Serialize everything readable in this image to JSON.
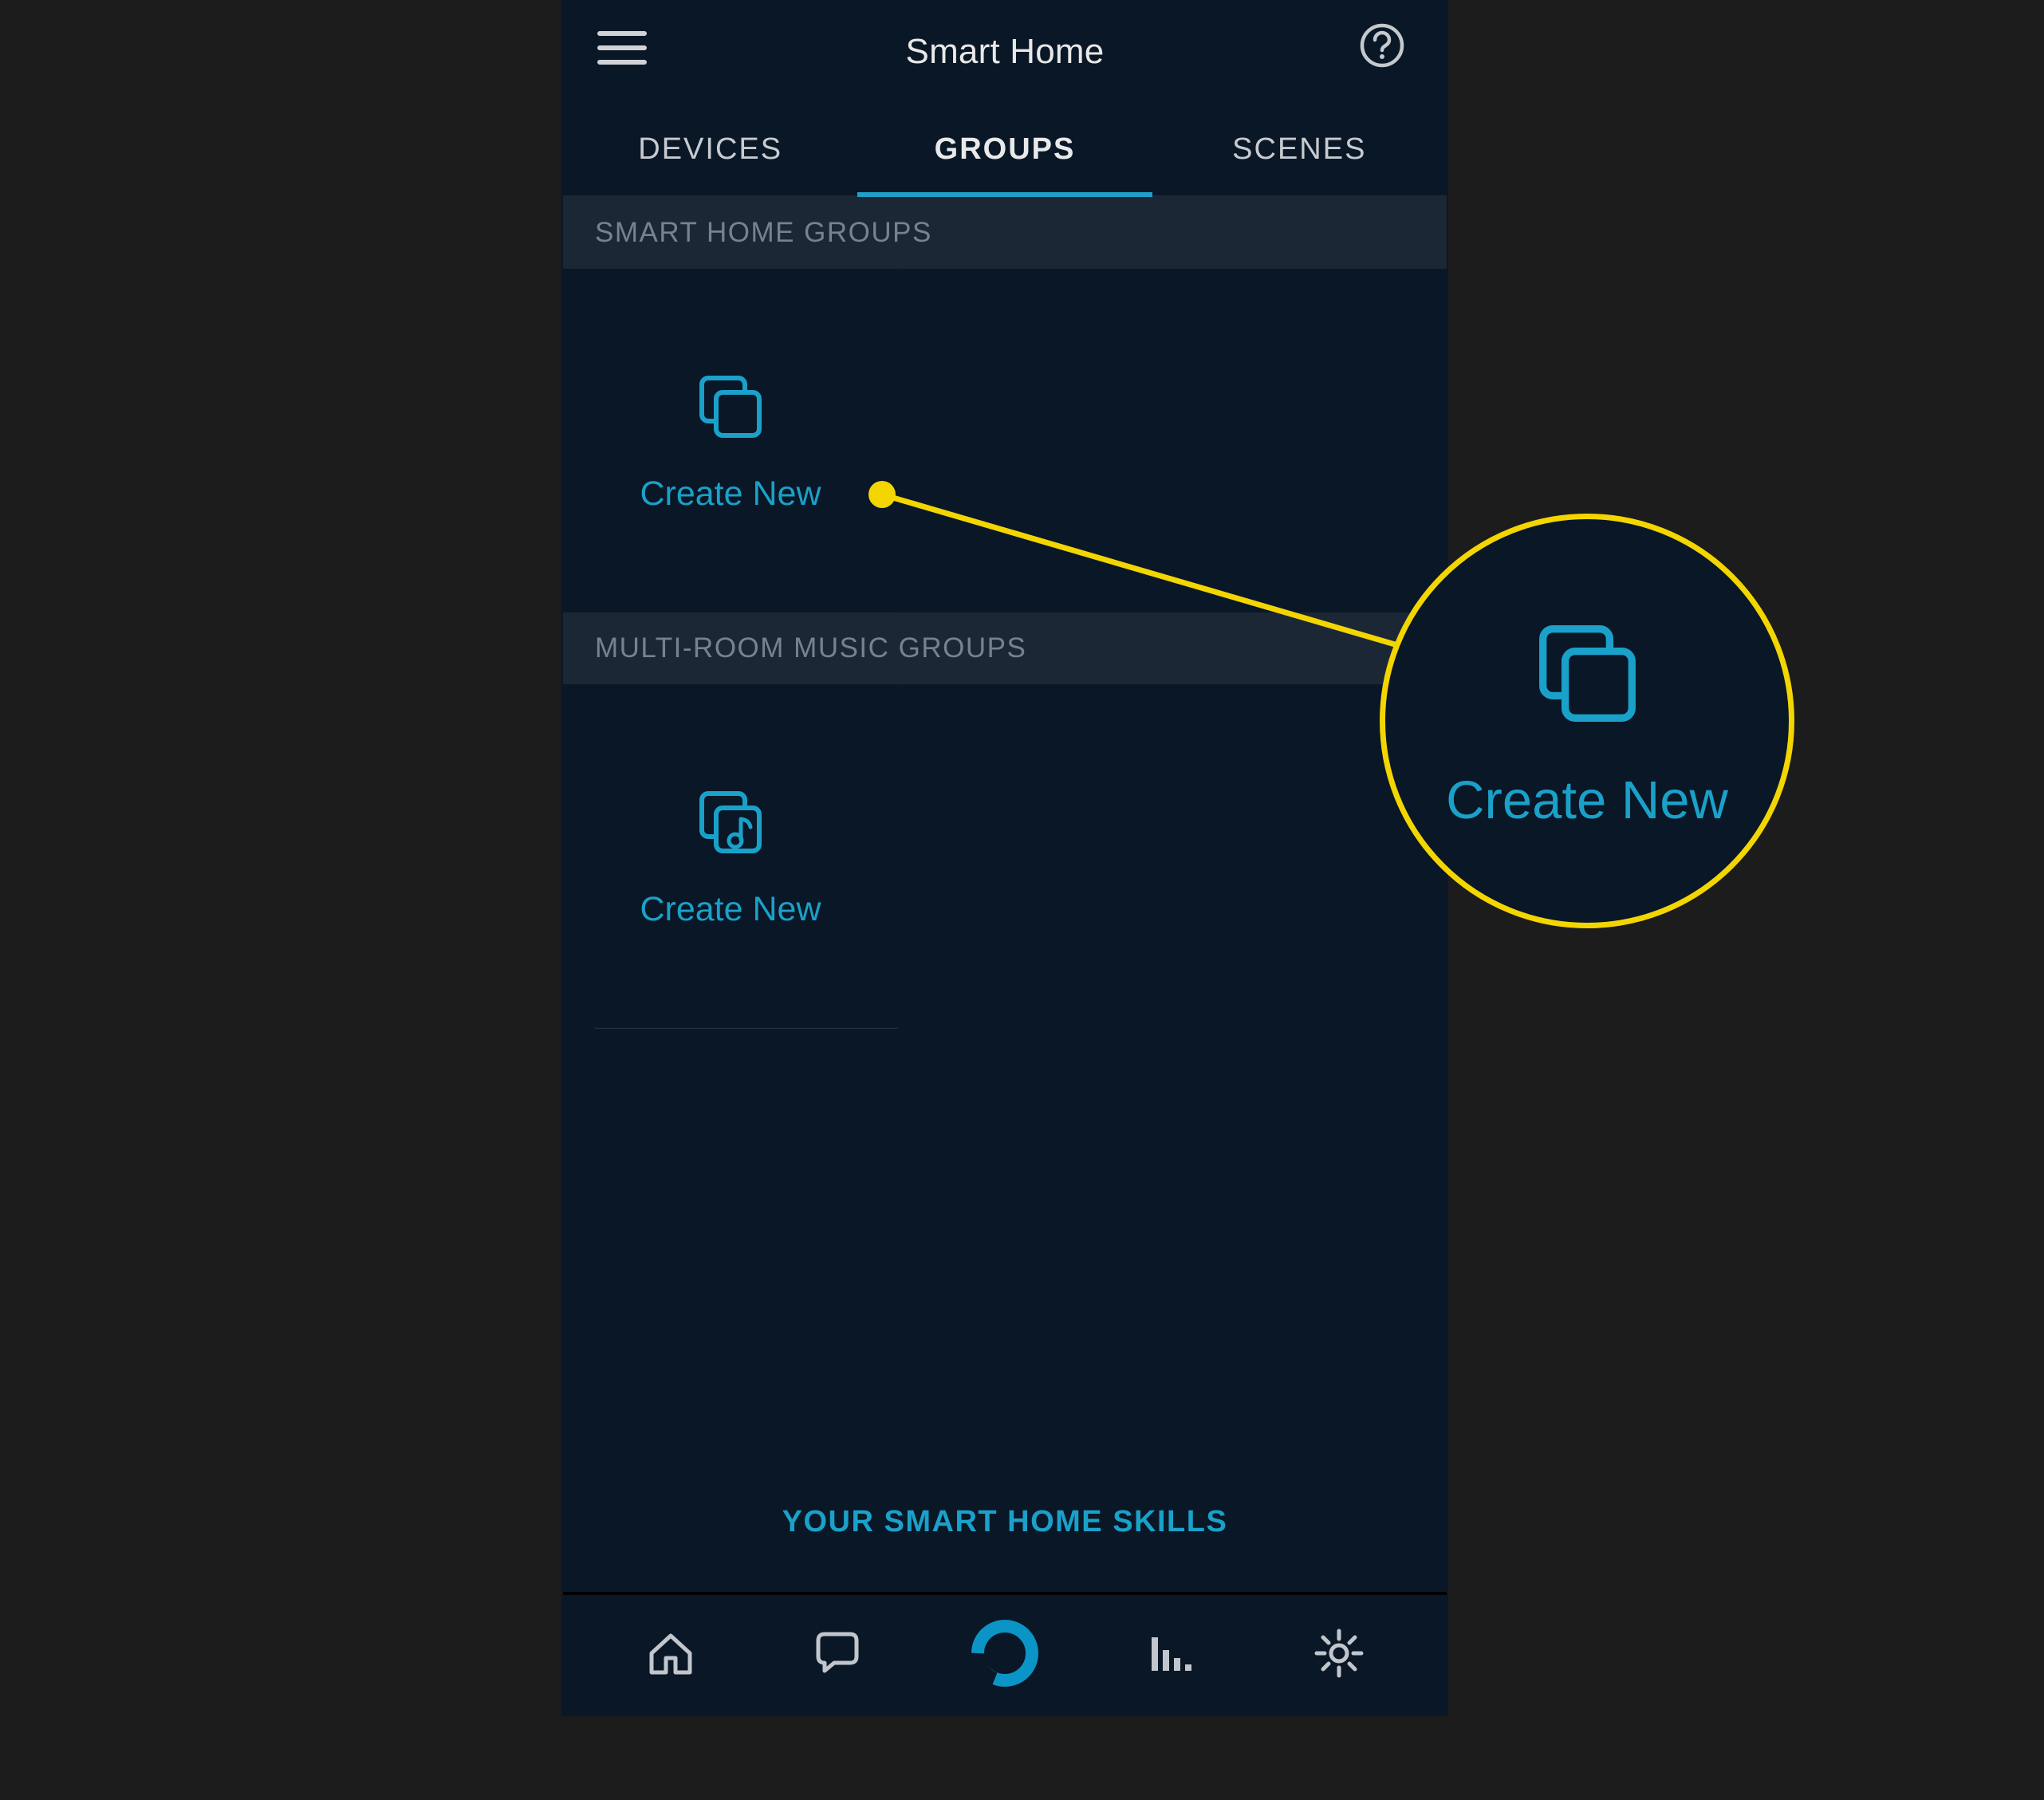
{
  "header": {
    "title": "Smart Home"
  },
  "tabs": {
    "devices": "DEVICES",
    "groups": "GROUPS",
    "scenes": "SCENES",
    "active": "groups"
  },
  "sections": {
    "smart_home_groups": {
      "header": "SMART HOME GROUPS",
      "create_label": "Create New"
    },
    "multi_room_music_groups": {
      "header": "MULTI-ROOM MUSIC GROUPS",
      "create_label": "Create New"
    }
  },
  "footer_link": "YOUR SMART HOME SKILLS",
  "callout": {
    "label": "Create New"
  },
  "colors": {
    "accent": "#1aa1c9",
    "highlight": "#f3d600",
    "background_dark": "#0a1727",
    "outer_bg": "#1c1c1c",
    "section_bg": "#1b2735"
  },
  "icons": {
    "hamburger": "hamburger-icon",
    "help": "help-icon",
    "groups": "stacked-squares-icon",
    "music_group": "stacked-squares-music-icon",
    "home": "home-icon",
    "chat": "chat-icon",
    "alexa": "alexa-ring-icon",
    "equalizer": "equalizer-icon",
    "settings": "gear-icon"
  }
}
